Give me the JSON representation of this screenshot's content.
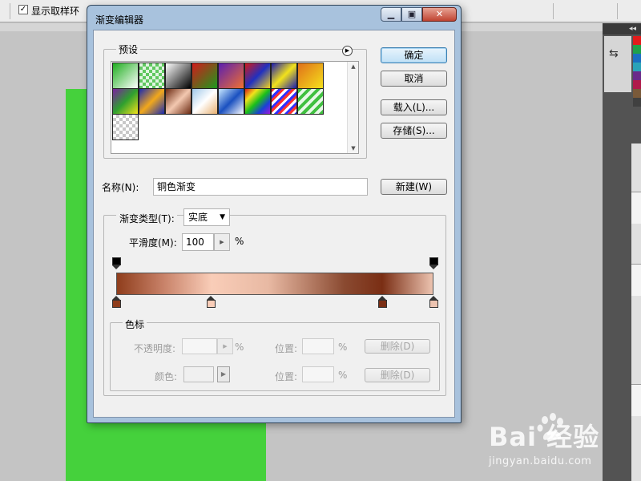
{
  "app": {
    "options": {
      "show_ring_checked": "✓",
      "show_ring_label": "显示取样环"
    },
    "panel": {
      "collapse_glyph": "◂◂"
    },
    "watermark": {
      "logo": "Bai 经验",
      "url": "jingyan.baidu.com"
    }
  },
  "dialog": {
    "title": "渐变编辑器",
    "window_buttons": {
      "minimize": "▁",
      "maximize": "▣",
      "close": "✕"
    },
    "presets": {
      "legend": "预设",
      "menu_glyph": "▶",
      "swatches": [
        "linear-gradient(135deg,#1fae1f,#ffffff)",
        "repeating-conic-gradient(#60c860 0 25%,#e0f5e0 0 50%) 0 0/8px 8px",
        "linear-gradient(135deg,#ffffff,#000000)",
        "linear-gradient(135deg,#d11b1b,#1d9a1d)",
        "linear-gradient(135deg,#5a1fb0,#f07030)",
        "linear-gradient(135deg,#d21a1a,#2030c0,#f2d41b)",
        "linear-gradient(135deg,#1a1ab0,#f2e21b,#1a1ab0)",
        "linear-gradient(135deg,#e0701a,#f5e11b)",
        "linear-gradient(135deg,#7a1fa0,#2fa02f,#f2e21b)",
        "linear-gradient(135deg,#1a2ab0,#f2a81b,#1a2ab0)",
        "linear-gradient(135deg,#6b2a12,#f3c8b0,#6b2a12)",
        "linear-gradient(135deg,#a0c8e8,#ffffff,#e8b070)",
        "linear-gradient(135deg,#c8e8ff,#1a50c0,#ffffff)",
        "linear-gradient(135deg,#d81a1a,#f2e21b,#1ac01a,#1a40d8,#a01ad8)",
        "repeating-linear-gradient(135deg,#ff3030 0 3px,#ffffff 3px 6px,#3030ff 6px 9px)",
        "repeating-linear-gradient(135deg,#40c040 0 4px,#e8f8e8 4px 8px)",
        "repeating-conic-gradient(#c8c8c8 0 25%,#ffffff 0 50%) 0 0/8px 8px"
      ],
      "scroll_up": "▲",
      "scroll_down": "▼"
    },
    "buttons": {
      "ok": "确定",
      "cancel": "取消",
      "load": "载入(L)...",
      "save": "存储(S)...",
      "new": "新建(W)"
    },
    "name": {
      "label": "名称(N):",
      "value": "铜色渐变"
    },
    "gradient": {
      "type_label": "渐变类型(T):",
      "type_value": "实底",
      "dropdown_glyph": "▼",
      "smooth_label": "平滑度(M):",
      "smooth_value": "100",
      "smooth_unit": "%",
      "stepper_glyph": "▶",
      "opacity_stops": [
        {
          "position": 0,
          "color": "#000000"
        },
        {
          "position": 100,
          "color": "#000000"
        }
      ],
      "color_stops": [
        {
          "position": 0,
          "color": "#8f3d1c"
        },
        {
          "position": 30,
          "color": "#f9cdb8"
        },
        {
          "position": 84,
          "color": "#7a2e14"
        },
        {
          "position": 100,
          "color": "#ecc3b0"
        }
      ]
    },
    "stops": {
      "legend": "色标",
      "opacity_label": "不透明度:",
      "opacity_unit": "%",
      "location_label": "位置:",
      "location_unit": "%",
      "delete_label": "删除(D)",
      "color_label": "颜色:",
      "location_label_2": "位置:",
      "location_unit_2": "%",
      "delete_label_2": "删除(D)",
      "color_arrow": "▶"
    }
  }
}
